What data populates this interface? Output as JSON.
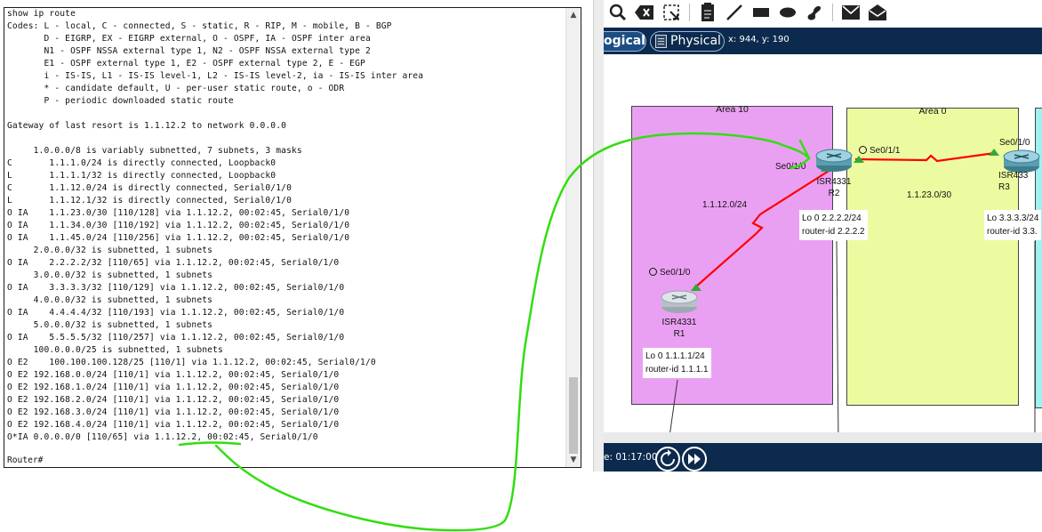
{
  "terminal": {
    "lines": [
      "show ip route",
      "Codes: L - local, C - connected, S - static, R - RIP, M - mobile, B - BGP",
      "       D - EIGRP, EX - EIGRP external, O - OSPF, IA - OSPF inter area",
      "       N1 - OSPF NSSA external type 1, N2 - OSPF NSSA external type 2",
      "       E1 - OSPF external type 1, E2 - OSPF external type 2, E - EGP",
      "       i - IS-IS, L1 - IS-IS level-1, L2 - IS-IS level-2, ia - IS-IS inter area",
      "       * - candidate default, U - per-user static route, o - ODR",
      "       P - periodic downloaded static route",
      "",
      "Gateway of last resort is 1.1.12.2 to network 0.0.0.0",
      "",
      "     1.0.0.0/8 is variably subnetted, 7 subnets, 3 masks",
      "C       1.1.1.0/24 is directly connected, Loopback0",
      "L       1.1.1.1/32 is directly connected, Loopback0",
      "C       1.1.12.0/24 is directly connected, Serial0/1/0",
      "L       1.1.12.1/32 is directly connected, Serial0/1/0",
      "O IA    1.1.23.0/30 [110/128] via 1.1.12.2, 00:02:45, Serial0/1/0",
      "O IA    1.1.34.0/30 [110/192] via 1.1.12.2, 00:02:45, Serial0/1/0",
      "O IA    1.1.45.0/24 [110/256] via 1.1.12.2, 00:02:45, Serial0/1/0",
      "     2.0.0.0/32 is subnetted, 1 subnets",
      "O IA    2.2.2.2/32 [110/65] via 1.1.12.2, 00:02:45, Serial0/1/0",
      "     3.0.0.0/32 is subnetted, 1 subnets",
      "O IA    3.3.3.3/32 [110/129] via 1.1.12.2, 00:02:45, Serial0/1/0",
      "     4.0.0.0/32 is subnetted, 1 subnets",
      "O IA    4.4.4.4/32 [110/193] via 1.1.12.2, 00:02:45, Serial0/1/0",
      "     5.0.0.0/32 is subnetted, 1 subnets",
      "O IA    5.5.5.5/32 [110/257] via 1.1.12.2, 00:02:45, Serial0/1/0",
      "     100.0.0.0/25 is subnetted, 1 subnets",
      "O E2    100.100.100.128/25 [110/1] via 1.1.12.2, 00:02:45, Serial0/1/0",
      "O E2 192.168.0.0/24 [110/1] via 1.1.12.2, 00:02:45, Serial0/1/0",
      "O E2 192.168.1.0/24 [110/1] via 1.1.12.2, 00:02:45, Serial0/1/0",
      "O E2 192.168.2.0/24 [110/1] via 1.1.12.2, 00:02:45, Serial0/1/0",
      "O E2 192.168.3.0/24 [110/1] via 1.1.12.2, 00:02:45, Serial0/1/0",
      "O E2 192.168.4.0/24 [110/1] via 1.1.12.2, 00:02:45, Serial0/1/0",
      "O*IA 0.0.0.0/0 [110/65] via 1.1.12.2, 00:02:45, Serial0/1/0"
    ],
    "prompt": "Router#"
  },
  "packet_tracer": {
    "tabs": {
      "logical": "ogical",
      "physical": "Physical"
    },
    "coordinates": "x: 944, y: 190",
    "time": "e: 01:17:00",
    "toolbar_icons": [
      "search-icon",
      "delete-icon",
      "resize-icon",
      "note-icon",
      "line-icon",
      "rectangle-icon",
      "ellipse-icon",
      "freeform-icon",
      "pdu-simple-icon",
      "pdu-complex-icon"
    ],
    "areas": {
      "area10": "Area 10",
      "area0": "Area 0"
    },
    "routers": {
      "r1": {
        "model": "ISR4331",
        "name": "R1",
        "port": "Se0/1/0"
      },
      "r2": {
        "model": "ISR4331",
        "name": "R2",
        "port_left": "Se0/1/0",
        "port_right": "Se0/1/1"
      },
      "r3": {
        "model": "ISR433",
        "name": "R3",
        "port": "Se0/1/0"
      }
    },
    "networks": {
      "n12": "1.1.12.0/24",
      "n23": "1.1.23.0/30"
    },
    "notes": {
      "r1": "Lo 0 1.1.1.1/24\nrouter-id 1.1.1.1",
      "r2": "Lo 0 2.2.2.2/24\nrouter-id 2.2.2.2",
      "r3": "Lo 3.3.3.3/24\nrouter-id 3.3."
    },
    "colors": {
      "area10": "#eaa0f2",
      "area0": "#ecfba0",
      "link": "#ff0000",
      "annotation": "#33dd11",
      "chrome": "#0c2a4d"
    }
  }
}
